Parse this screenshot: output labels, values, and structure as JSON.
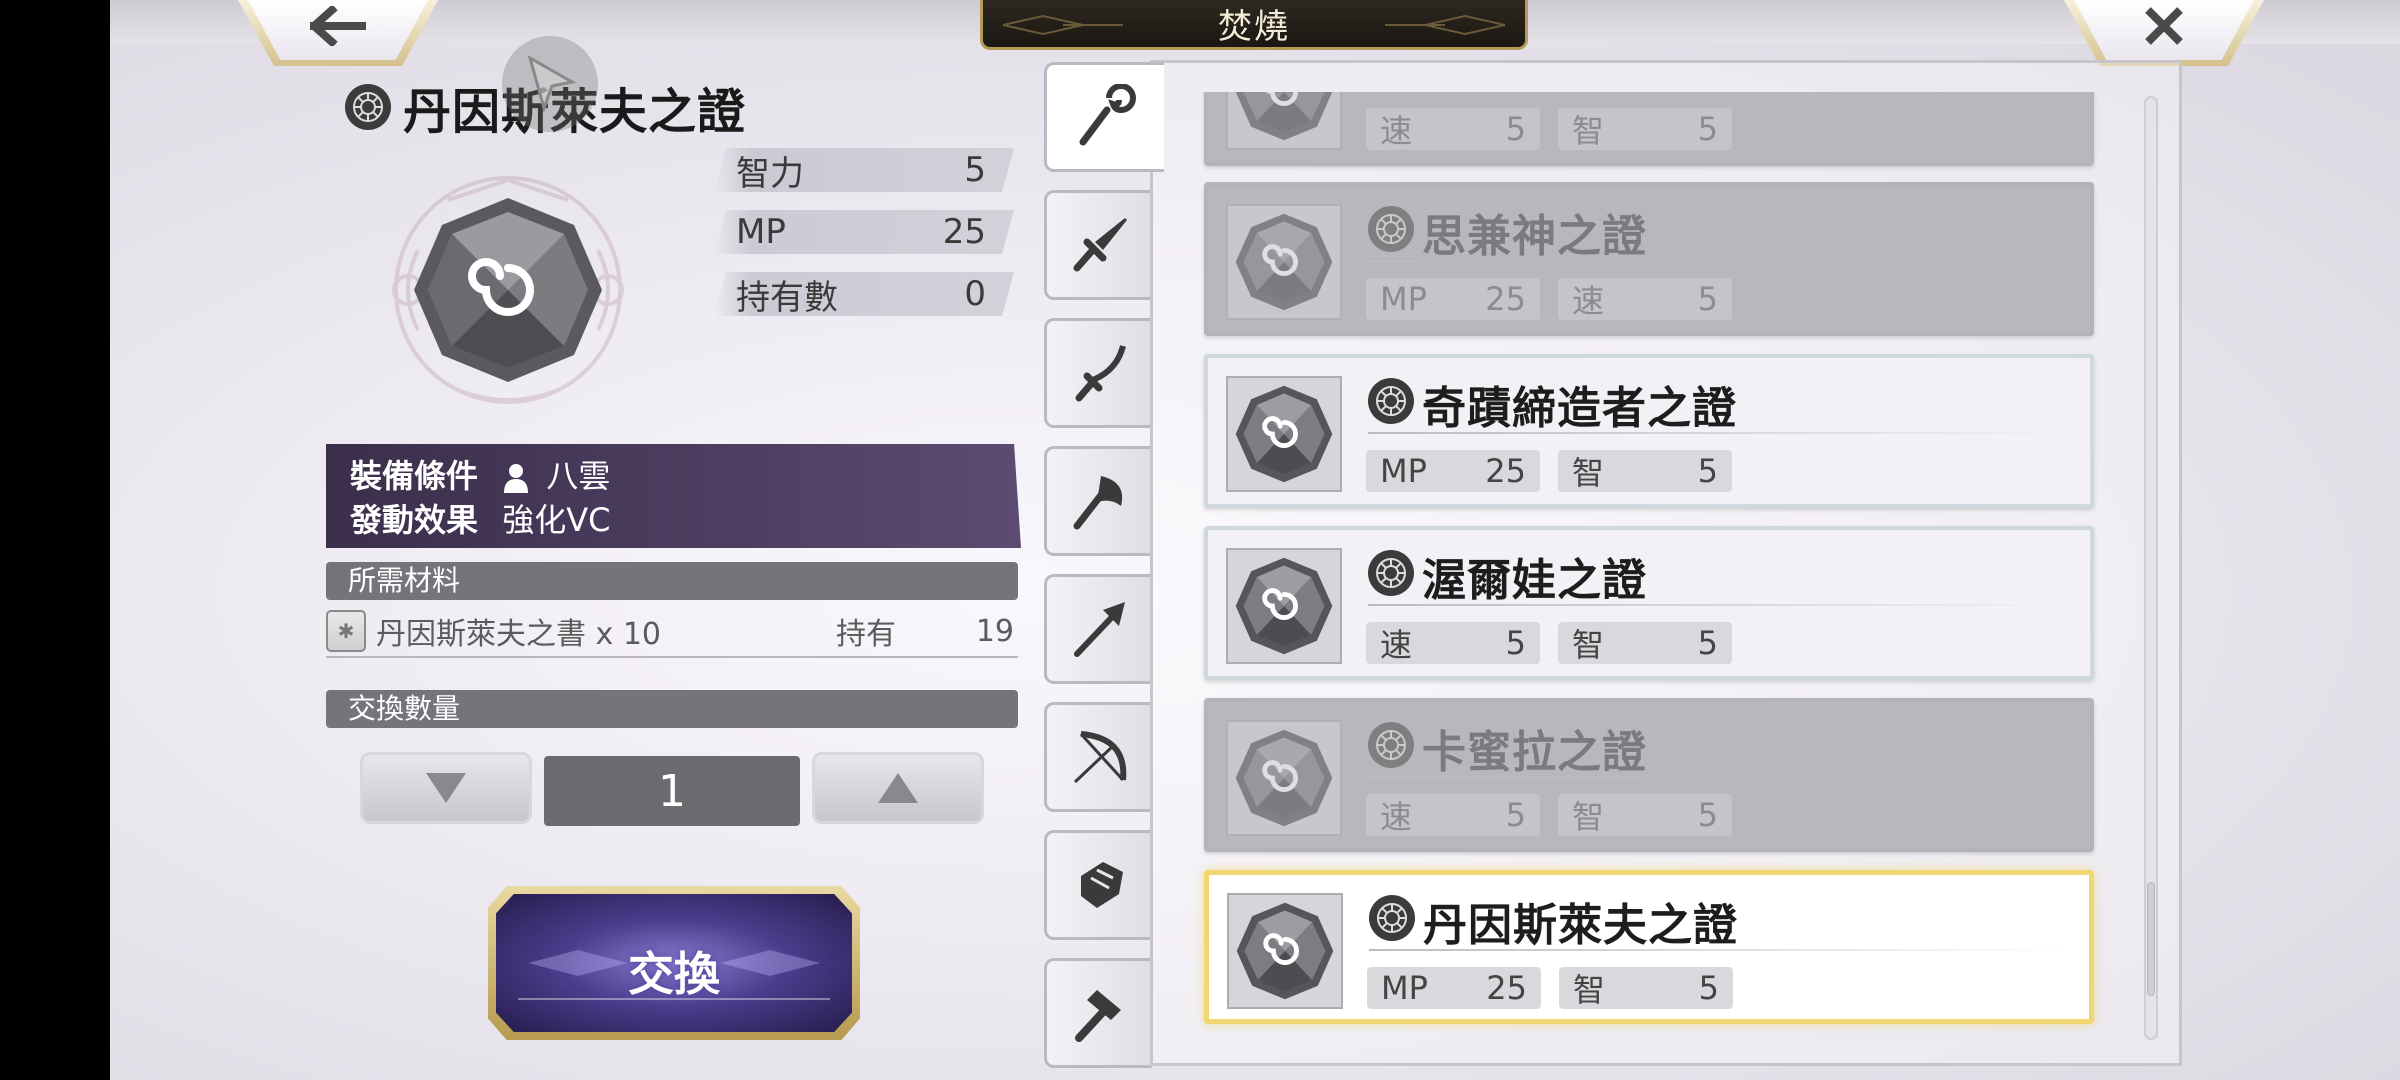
{
  "header": {
    "title": "焚燒",
    "back_icon": "left-arrow-icon",
    "close_icon": "close-icon"
  },
  "detail": {
    "name": "丹因斯萊夫之證",
    "stats": [
      {
        "label": "智力",
        "value": "5"
      },
      {
        "label": "MP",
        "value": "25"
      },
      {
        "label": "持有數",
        "value": "0"
      }
    ],
    "equip_condition_label": "裝備條件",
    "equip_condition_value": "八雲",
    "effect_label": "發動效果",
    "effect_value": "強化VC",
    "materials_header": "所需材料",
    "material_name": "丹因斯萊夫之書 x 10",
    "material_own_label": "持有",
    "material_own_value": "19",
    "quantity_header": "交換數量",
    "quantity_value": "1",
    "exchange_label": "交換"
  },
  "tabs": [
    {
      "name": "staff",
      "icon": "staff-icon",
      "active": true
    },
    {
      "name": "sword",
      "icon": "sword-icon",
      "active": false
    },
    {
      "name": "katana",
      "icon": "katana-icon",
      "active": false
    },
    {
      "name": "axe",
      "icon": "axe-icon",
      "active": false
    },
    {
      "name": "spear",
      "icon": "spear-icon",
      "active": false
    },
    {
      "name": "bow",
      "icon": "bow-icon",
      "active": false
    },
    {
      "name": "fist",
      "icon": "fist-icon",
      "active": false
    },
    {
      "name": "hammer",
      "icon": "hammer-icon",
      "active": false
    }
  ],
  "list": [
    {
      "name": "",
      "stat1_label": "速",
      "stat1_value": "5",
      "stat2_label": "智",
      "stat2_value": "5",
      "state": "dim"
    },
    {
      "name": "思兼神之證",
      "stat1_label": "MP",
      "stat1_value": "25",
      "stat2_label": "速",
      "stat2_value": "5",
      "state": "dim"
    },
    {
      "name": "奇蹟締造者之證",
      "stat1_label": "MP",
      "stat1_value": "25",
      "stat2_label": "智",
      "stat2_value": "5",
      "state": "normal"
    },
    {
      "name": "渥爾娃之證",
      "stat1_label": "速",
      "stat1_value": "5",
      "stat2_label": "智",
      "stat2_value": "5",
      "state": "normal"
    },
    {
      "name": "卡蜜拉之證",
      "stat1_label": "速",
      "stat1_value": "5",
      "stat2_label": "智",
      "stat2_value": "5",
      "state": "dim"
    },
    {
      "name": "丹因斯萊夫之證",
      "stat1_label": "MP",
      "stat1_value": "25",
      "stat2_label": "智",
      "stat2_value": "5",
      "state": "selected"
    }
  ],
  "colors": {
    "accent_gold": "#f1d671",
    "panel_purple": "#4e3f62",
    "section_gray": "#77737a"
  }
}
